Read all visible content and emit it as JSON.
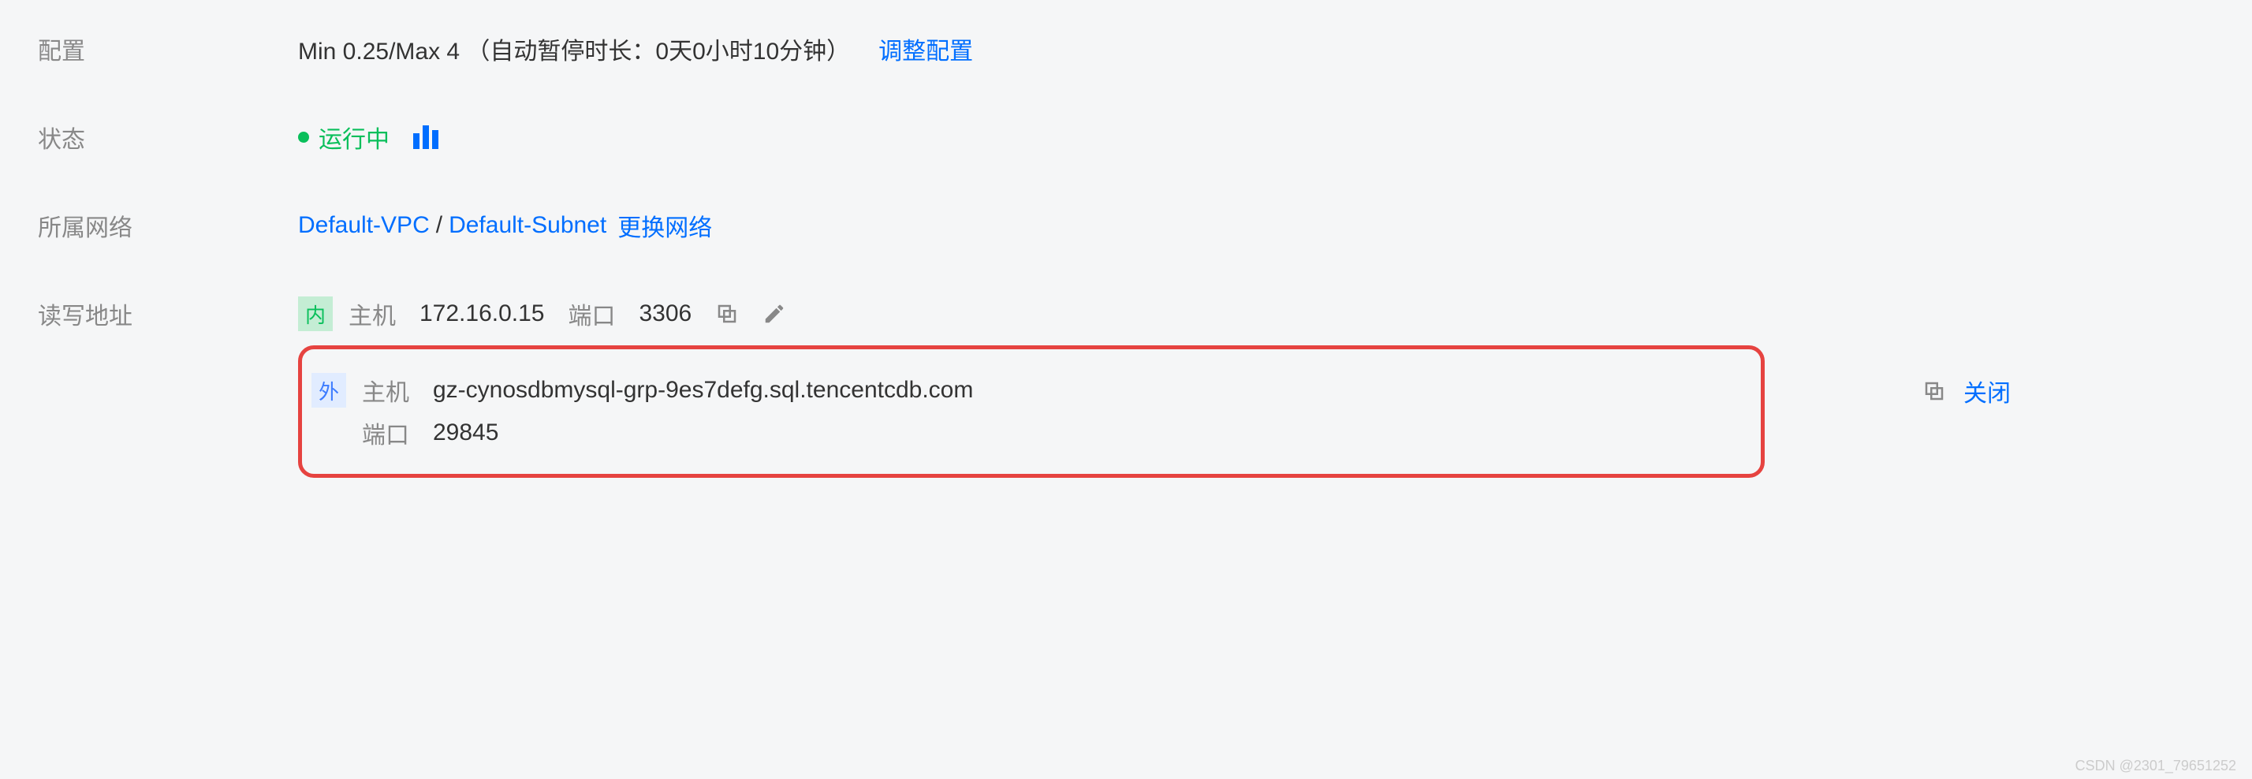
{
  "config": {
    "label": "配置",
    "value": "Min 0.25/Max 4 （自动暂停时长：0天0小时10分钟）",
    "adjust_link": "调整配置"
  },
  "status": {
    "label": "状态",
    "text": "运行中"
  },
  "network": {
    "label": "所属网络",
    "vpc_link": "Default-VPC",
    "subnet_link": "Default-Subnet",
    "change_link": "更换网络"
  },
  "address": {
    "label": "读写地址",
    "internal_badge": "内",
    "external_badge": "外",
    "host_label": "主机",
    "port_label": "端口",
    "internal": {
      "host": "172.16.0.15",
      "port": "3306"
    },
    "external": {
      "host": "gz-cynosdbmysql-grp-9es7defg.sql.tencentcdb.com",
      "port": "29845"
    },
    "close_link": "关闭"
  },
  "watermark": "CSDN @2301_79651252"
}
